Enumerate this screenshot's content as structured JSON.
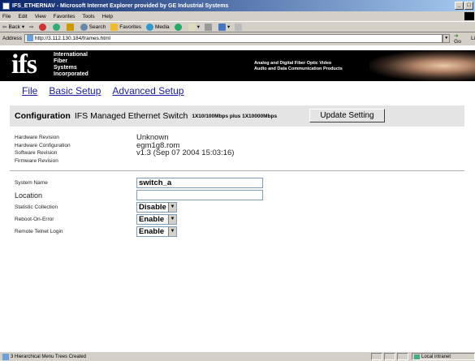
{
  "window": {
    "title": "IFS_ETHERNAV - Microsoft Internet Explorer provided by GE Industrial Systems",
    "minimize": "_",
    "restore": "3"
  },
  "menubar": [
    "File",
    "Edit",
    "View",
    "Favorites",
    "Tools",
    "Help"
  ],
  "toolbar": {
    "back": "Back",
    "search": "Search",
    "favorites": "Favorites",
    "media": "Media"
  },
  "address": {
    "label": "Address",
    "url": "http://3.112.130.184/frames.html",
    "go": "Go",
    "links": "Li"
  },
  "banner": {
    "logo": "ifs",
    "company": [
      "International",
      "Fiber",
      "Systems",
      "Incorporated"
    ],
    "tagline": [
      "Analog and Digital Fiber Optic Video",
      "Audio and Data Communication Products"
    ]
  },
  "nav": [
    "File",
    "Basic Setup",
    "Advanced Setup"
  ],
  "config": {
    "title": "Configuration",
    "product": "IFS Managed Ethernet Switch",
    "ports": "1X10/100Mbps plus 1X10000Mbps",
    "update_button": "Update Setting"
  },
  "info": [
    {
      "label": "Hardware Revision",
      "value": "Unknown"
    },
    {
      "label": "Hardware Configuration",
      "value": "egm1g8.rom"
    },
    {
      "label": "Software Revision",
      "value": "v1.3 (Sep 07 2004 15:03:16)"
    },
    {
      "label": "Firmware Revision",
      "value": ""
    }
  ],
  "form": {
    "system_name_label": "System Name",
    "system_name_value": "switch_a",
    "location_label": "Location",
    "location_value": "",
    "statistic_label": "Statistic Collection",
    "statistic_value": "Disable",
    "reboot_label": "Reboot-On-Error",
    "reboot_value": "Enable",
    "telnet_label": "Remote Telnet Login",
    "telnet_value": "Enable"
  },
  "status": {
    "message": "3 Hierarchical Menu Trees Created",
    "zone": "Local intranet"
  }
}
